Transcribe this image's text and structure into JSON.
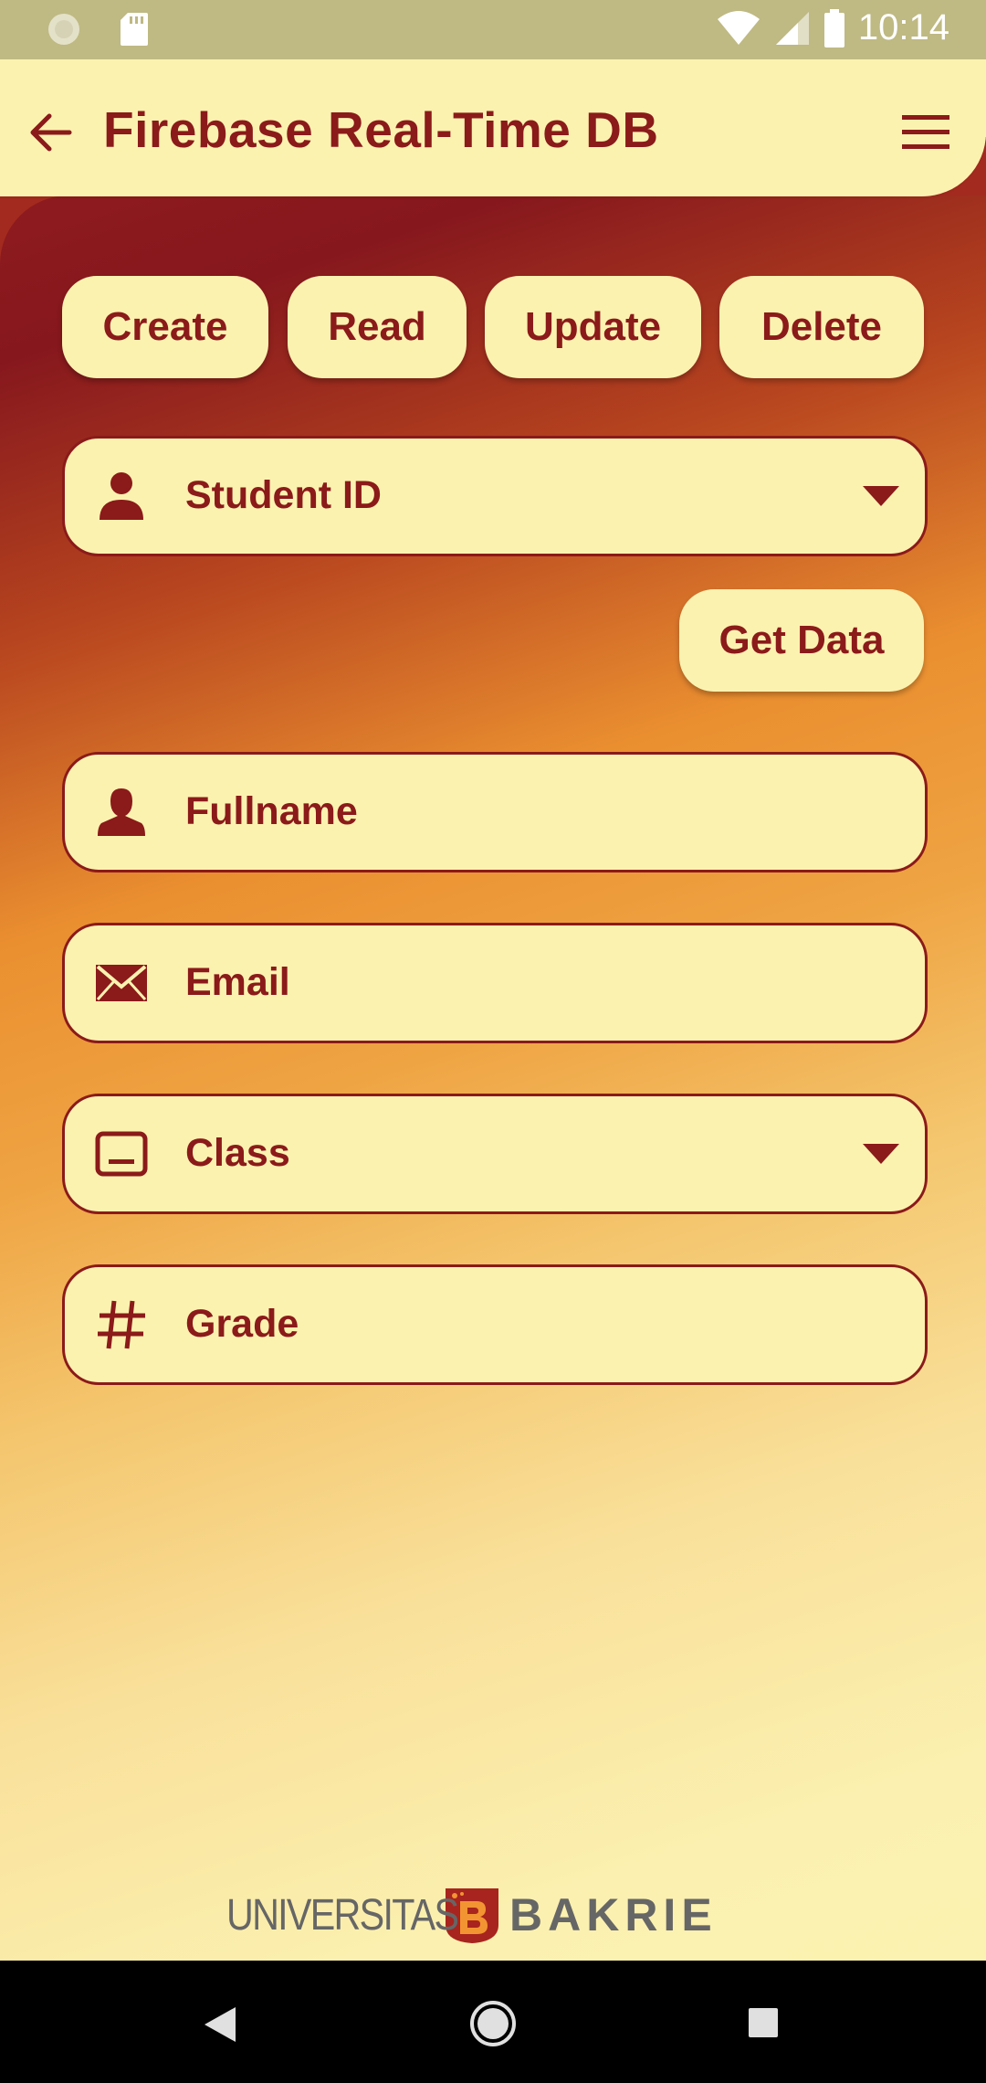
{
  "status_bar": {
    "time": "10:14",
    "icons": [
      "sync-icon",
      "sd-card-icon",
      "wifi-icon",
      "signal-icon",
      "battery-icon"
    ]
  },
  "app_bar": {
    "title": "Firebase Real-Time DB",
    "back_icon": "arrow-left-icon",
    "menu_icon": "hamburger-menu-icon"
  },
  "actions": {
    "create": "Create",
    "read": "Read",
    "update": "Update",
    "delete": "Delete"
  },
  "form": {
    "student_id": {
      "label": "Student ID",
      "icon": "person-icon"
    },
    "get_data": "Get Data",
    "fullname": {
      "label": "Fullname",
      "icon": "person-silhouette-icon"
    },
    "email": {
      "label": "Email",
      "icon": "envelope-icon"
    },
    "class": {
      "label": "Class",
      "icon": "class-icon"
    },
    "grade": {
      "label": "Grade",
      "icon": "hash-icon"
    }
  },
  "footer": {
    "logo_left": "UNIVERSITAS",
    "logo_right": "BAKRIE"
  },
  "colors": {
    "primary": "#8b1a1a",
    "surface": "#fbf2b0",
    "gradient_top": "#86171d",
    "gradient_mid": "#ea8f30",
    "status_bar": "#bfb983"
  }
}
